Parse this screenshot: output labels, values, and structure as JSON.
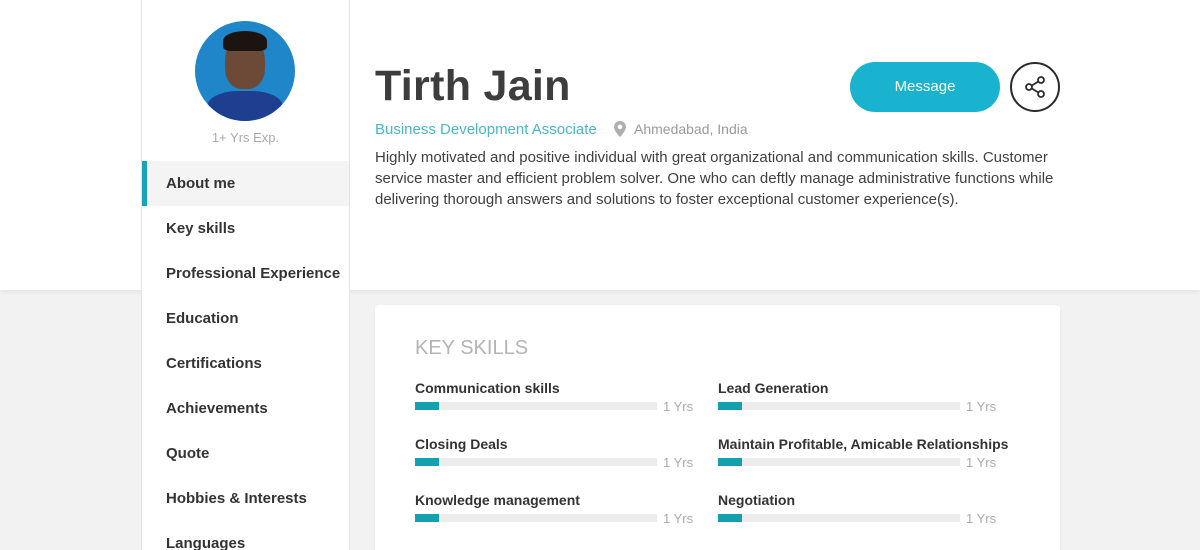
{
  "profile": {
    "name": "Tirth Jain",
    "role": "Business Development Associate",
    "location": "Ahmedabad, India",
    "experience": "1+ Yrs Exp.",
    "bio": "Highly motivated and positive individual with great organizational and communication skills. Customer service master and efficient problem solver. One who can deftly manage administrative functions while delivering thorough answers and solutions to foster exceptional customer experience(s)."
  },
  "actions": {
    "message_label": "Message",
    "share_icon": "share-icon"
  },
  "sidebar": {
    "items": [
      {
        "label": "About me",
        "active": true
      },
      {
        "label": "Key skills"
      },
      {
        "label": "Professional Experience"
      },
      {
        "label": "Education"
      },
      {
        "label": "Certifications"
      },
      {
        "label": "Achievements"
      },
      {
        "label": "Quote"
      },
      {
        "label": "Hobbies & Interests"
      },
      {
        "label": "Languages"
      }
    ]
  },
  "skills_section": {
    "title": "KEY SKILLS",
    "skills": [
      {
        "name": "Communication skills",
        "years": "1 Yrs",
        "level": 0.1
      },
      {
        "name": "Lead Generation",
        "years": "1 Yrs",
        "level": 0.1
      },
      {
        "name": "Closing Deals",
        "years": "1 Yrs",
        "level": 0.1
      },
      {
        "name": "Maintain Profitable, Amicable Relationships",
        "years": "1 Yrs",
        "level": 0.1
      },
      {
        "name": "Knowledge management",
        "years": "1 Yrs",
        "level": 0.1
      },
      {
        "name": "Negotiation",
        "years": "1 Yrs",
        "level": 0.1
      }
    ]
  },
  "colors": {
    "accent": "#1ab3cf",
    "skill_fill": "#15a0b0",
    "role_text": "#4ab6c8"
  }
}
